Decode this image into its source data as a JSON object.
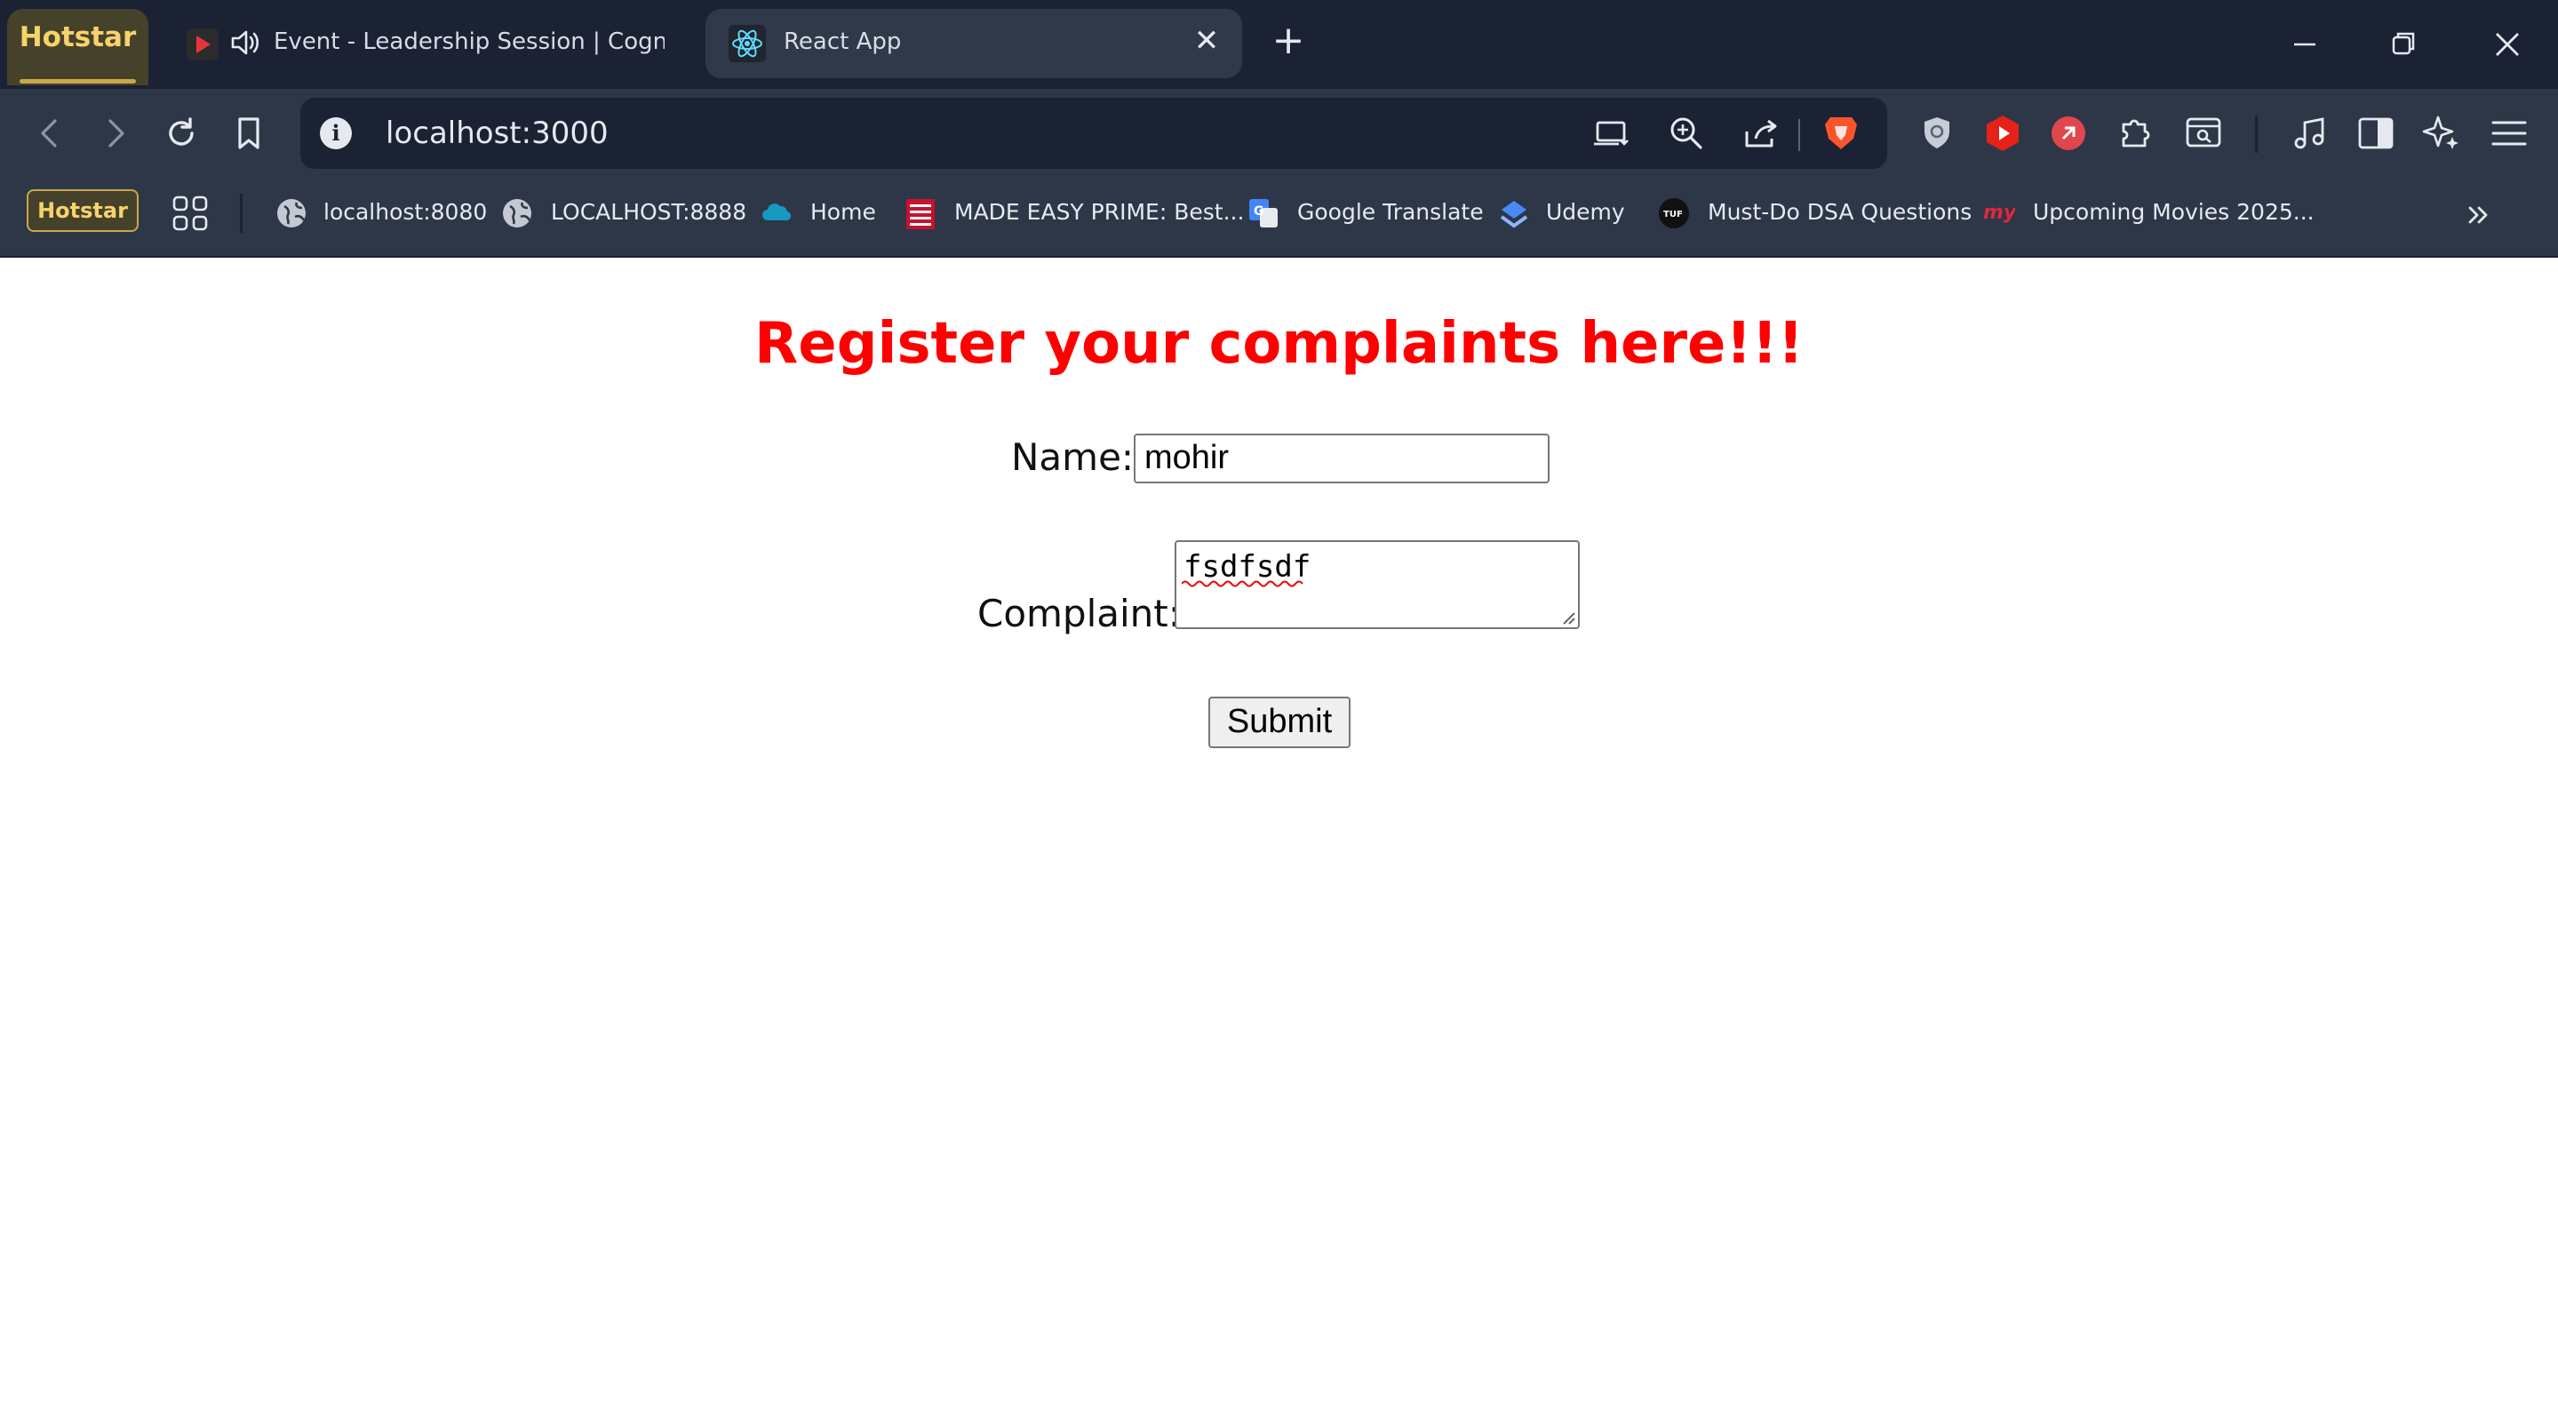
{
  "browser": {
    "tab_group_label": "Hotstar",
    "tabs": [
      {
        "title": "Event - Leadership Session | Cognizant-E",
        "audio": true,
        "icon": "play-logo-icon"
      },
      {
        "title": "React App",
        "active": true,
        "icon": "react-logo-icon"
      }
    ],
    "address": "localhost:3000",
    "bookmark_group_label": "Hotstar",
    "bookmarks": [
      {
        "label": "localhost:8080",
        "icon": "globe-icon"
      },
      {
        "label": "LOCALHOST:8888",
        "icon": "globe-icon"
      },
      {
        "label": "Home",
        "icon": "salesforce-cloud-icon"
      },
      {
        "label": "MADE EASY PRIME: Best...",
        "icon": "made-easy-icon"
      },
      {
        "label": "Google Translate",
        "icon": "google-translate-icon"
      },
      {
        "label": "Udemy",
        "icon": "udemy-icon"
      },
      {
        "label": "Must-Do DSA Questions",
        "icon": "tuf-icon"
      },
      {
        "label": "Upcoming Movies 2025...",
        "icon": "my-icon"
      }
    ],
    "colors": {
      "chrome_dark": "#1a2233",
      "chrome": "#2d3748",
      "group_gold": "#f6d36b"
    }
  },
  "page": {
    "heading": "Register your complaints here!!!",
    "heading_color": "#ff0000",
    "name_label": "Name:",
    "name_value": "mohir",
    "complaint_label": "Complaint:",
    "complaint_value": "fsdfsdf",
    "submit_label": "Submit"
  }
}
